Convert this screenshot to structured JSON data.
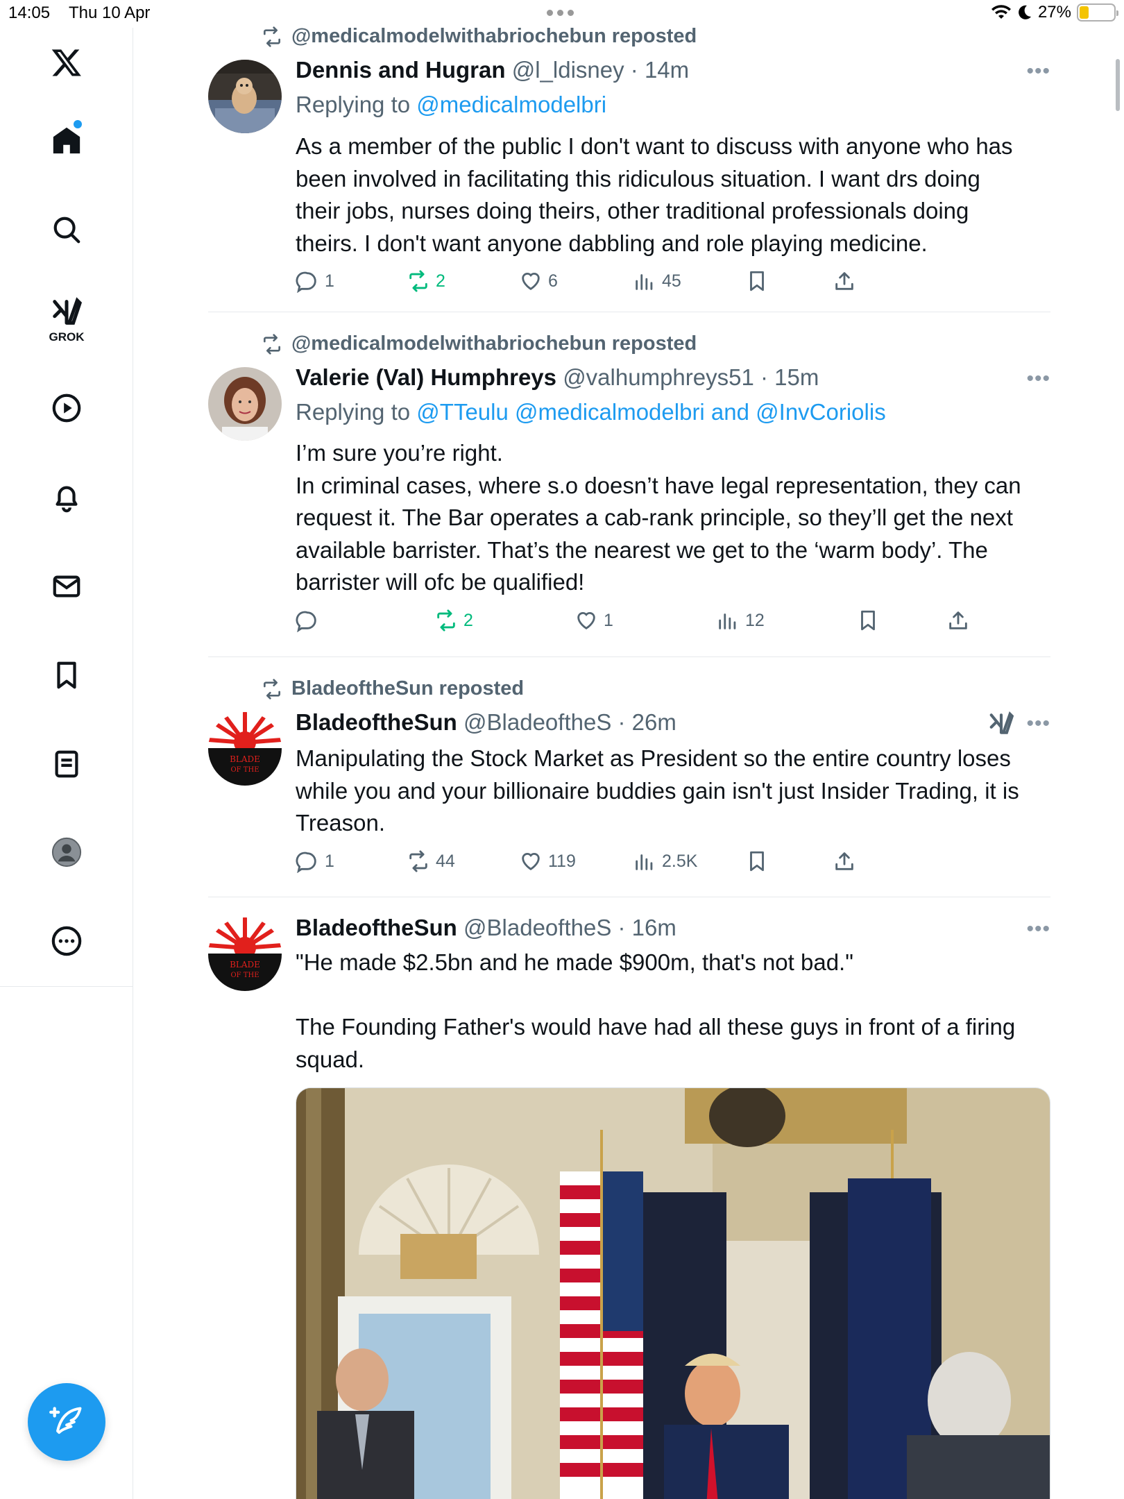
{
  "status_bar": {
    "time": "14:05",
    "date": "Thu 10 Apr",
    "battery": "27%",
    "battery_level": 0.27
  },
  "sidebar": {
    "items": [
      {
        "icon": "x-logo-icon"
      },
      {
        "icon": "home-icon",
        "has_notification": true
      },
      {
        "icon": "search-icon"
      },
      {
        "icon": "grok-icon",
        "label": "GROK"
      },
      {
        "icon": "video-icon"
      },
      {
        "icon": "bell-icon"
      },
      {
        "icon": "mail-icon"
      },
      {
        "icon": "bookmark-icon"
      },
      {
        "icon": "lists-icon"
      },
      {
        "icon": "profile-icon"
      },
      {
        "icon": "more-icon"
      }
    ],
    "compose_icon": "compose-icon"
  },
  "colors": {
    "accent": "#1d9bf0",
    "green": "#00ba7c",
    "secondary_text": "#536471"
  },
  "posts": [
    {
      "repost_by": "@medicalmodelwithabriochebun reposted",
      "name": "Dennis and Hugran",
      "handle": "@l_ldisney",
      "time": "· 14m",
      "reply_prefix": "Replying to",
      "reply_to": "@medicalmodelbri",
      "text": "As a member of the public I don't want to discuss with anyone who has\nbeen involved in facilitating this ridiculous situation. I want drs doing\ntheir jobs, nurses doing theirs, other traditional professionals  doing\ntheirs. I don't want anyone dabbling and role playing medicine.",
      "replies": "1",
      "reposts": "2",
      "likes": "6",
      "views": "45"
    },
    {
      "repost_by": "@medicalmodelwithabriochebun reposted",
      "name": "Valerie (Val) Humphreys",
      "handle": "@valhumphreys51",
      "time": "· 15m",
      "reply_prefix": "Replying to",
      "reply_to": "@TTeulu @medicalmodelbri and @InvCoriolis",
      "text": "I’m sure you’re right.\nIn criminal cases, where s.o doesn’t have legal representation, they can\nrequest it. The Bar operates a cab-rank principle, so they’ll get the next\navailable barrister. That’s the nearest we get to the ‘warm body’. The\nbarrister will ofc be qualified!",
      "replies": "",
      "reposts": "2",
      "likes": "1",
      "views": "12"
    },
    {
      "repost_by": "BladeoftheSun reposted",
      "name": "BladeoftheSun",
      "handle": "@BladeoftheS",
      "time": "· 26m",
      "text": "Manipulating the Stock Market as President so the entire country loses\nwhile you and your billionaire buddies gain isn't just Insider Trading, it is\nTreason.",
      "replies": "1",
      "reposts": "44",
      "likes": "119",
      "views": "2.5K"
    },
    {
      "name": "BladeoftheSun",
      "handle": "@BladeoftheS",
      "time": "· 16m",
      "text": "\"He made $2.5bn and he made $900m, that's not bad.\"\n\nThe Founding Father's would have had all these guys in front of a firing\nsquad.",
      "avatar_text": "BLADE OF THE"
    }
  ]
}
